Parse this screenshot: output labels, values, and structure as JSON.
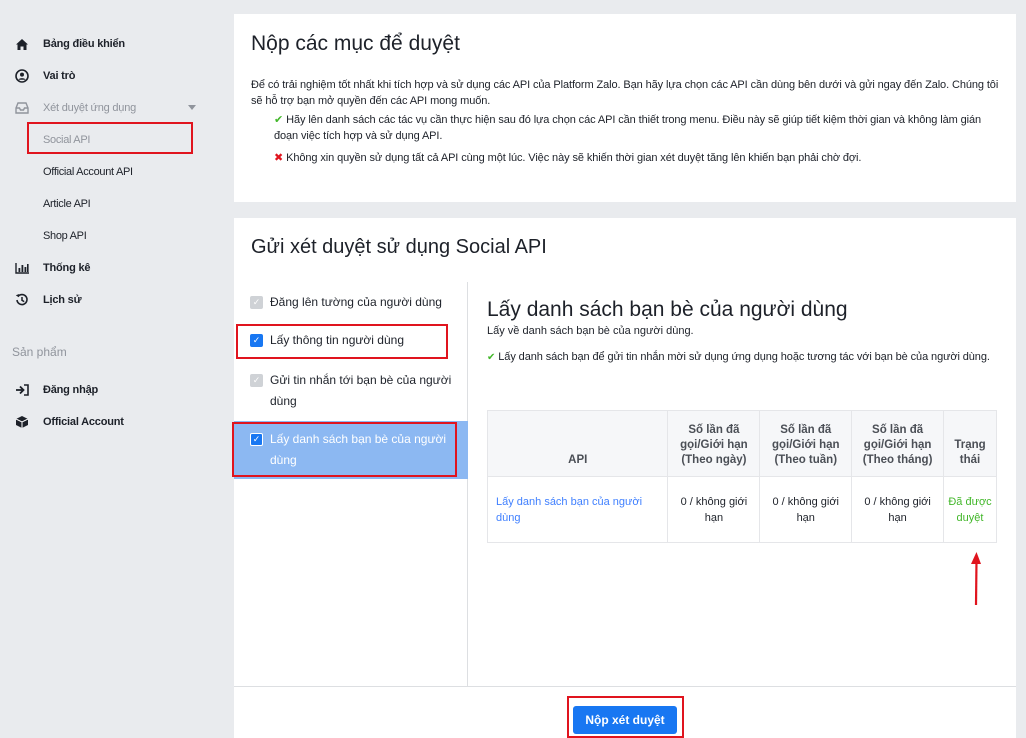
{
  "sidebar": {
    "dashboard": "Bảng điều khiển",
    "roles": "Vai trò",
    "app_review": "Xét duyệt ứng dụng",
    "sub_items": [
      "Social API",
      "Official Account API",
      "Article API",
      "Shop API"
    ],
    "stats": "Thống kê",
    "history": "Lịch sử",
    "products_label": "Sản phẩm",
    "login": "Đăng nhập",
    "official_account": "Official Account"
  },
  "intro_card": {
    "title": "Nộp các mục để duyệt",
    "paragraph": "Để có trải nghiệm tốt nhất khi tích hợp và sử dụng các API của Platform Zalo. Bạn hãy lựa chọn các API cần dùng bên dưới và gửi ngay đến Zalo. Chúng tôi sẽ hỗ trợ bạn mở quyền đến các API mong muốn.",
    "do_tip": "Hãy lên danh sách các tác vụ cần thực hiện sau đó lựa chọn các API cần thiết trong menu. Điều này sẽ giúp tiết kiệm thời gian và không làm gián đoạn việc tích hợp và sử dụng API.",
    "dont_tip": "Không xin quyền sử dụng tất cả API cùng một lúc. Việc này sẽ khiến thời gian xét duyệt tăng lên khiến bạn phải chờ đợi."
  },
  "review_card": {
    "title": "Gửi xét duyệt sử dụng Social API",
    "api_items": [
      {
        "label": "Đăng lên tường của người dùng",
        "state": "disabled"
      },
      {
        "label": "Lấy thông tin người dùng",
        "state": "checked"
      },
      {
        "label": "Gửi tin nhắn tới bạn bè của người dùng",
        "state": "disabled"
      },
      {
        "label": "Lấy danh sách bạn bè của người dùng",
        "state": "checked-selected"
      }
    ],
    "detail": {
      "title": "Lấy danh sách bạn bè của người dùng",
      "description": "Lấy về danh sách bạn bè của người dùng.",
      "note": "Lấy danh sách bạn để gửi tin nhắn mời sử dụng ứng dụng hoặc tương tác với bạn bè của người dùng."
    },
    "table": {
      "headers": [
        "API",
        "Số lần đã gọi/Giới hạn (Theo ngày)",
        "Số lần đã gọi/Giới hạn (Theo tuần)",
        "Số lần đã gọi/Giới hạn (Theo tháng)",
        "Trạng thái"
      ],
      "row": [
        "Lấy danh sách bạn của người dùng",
        "0 / không giới hạn",
        "0 / không giới hạn",
        "0 / không giới hạn",
        "Đã được duyệt"
      ]
    },
    "submit_label": "Nộp xét duyệt"
  },
  "colors": {
    "accent": "#1877f2",
    "selected_row": "#8cb8f2",
    "approved": "#42b72a",
    "highlight": "#e0141e"
  }
}
